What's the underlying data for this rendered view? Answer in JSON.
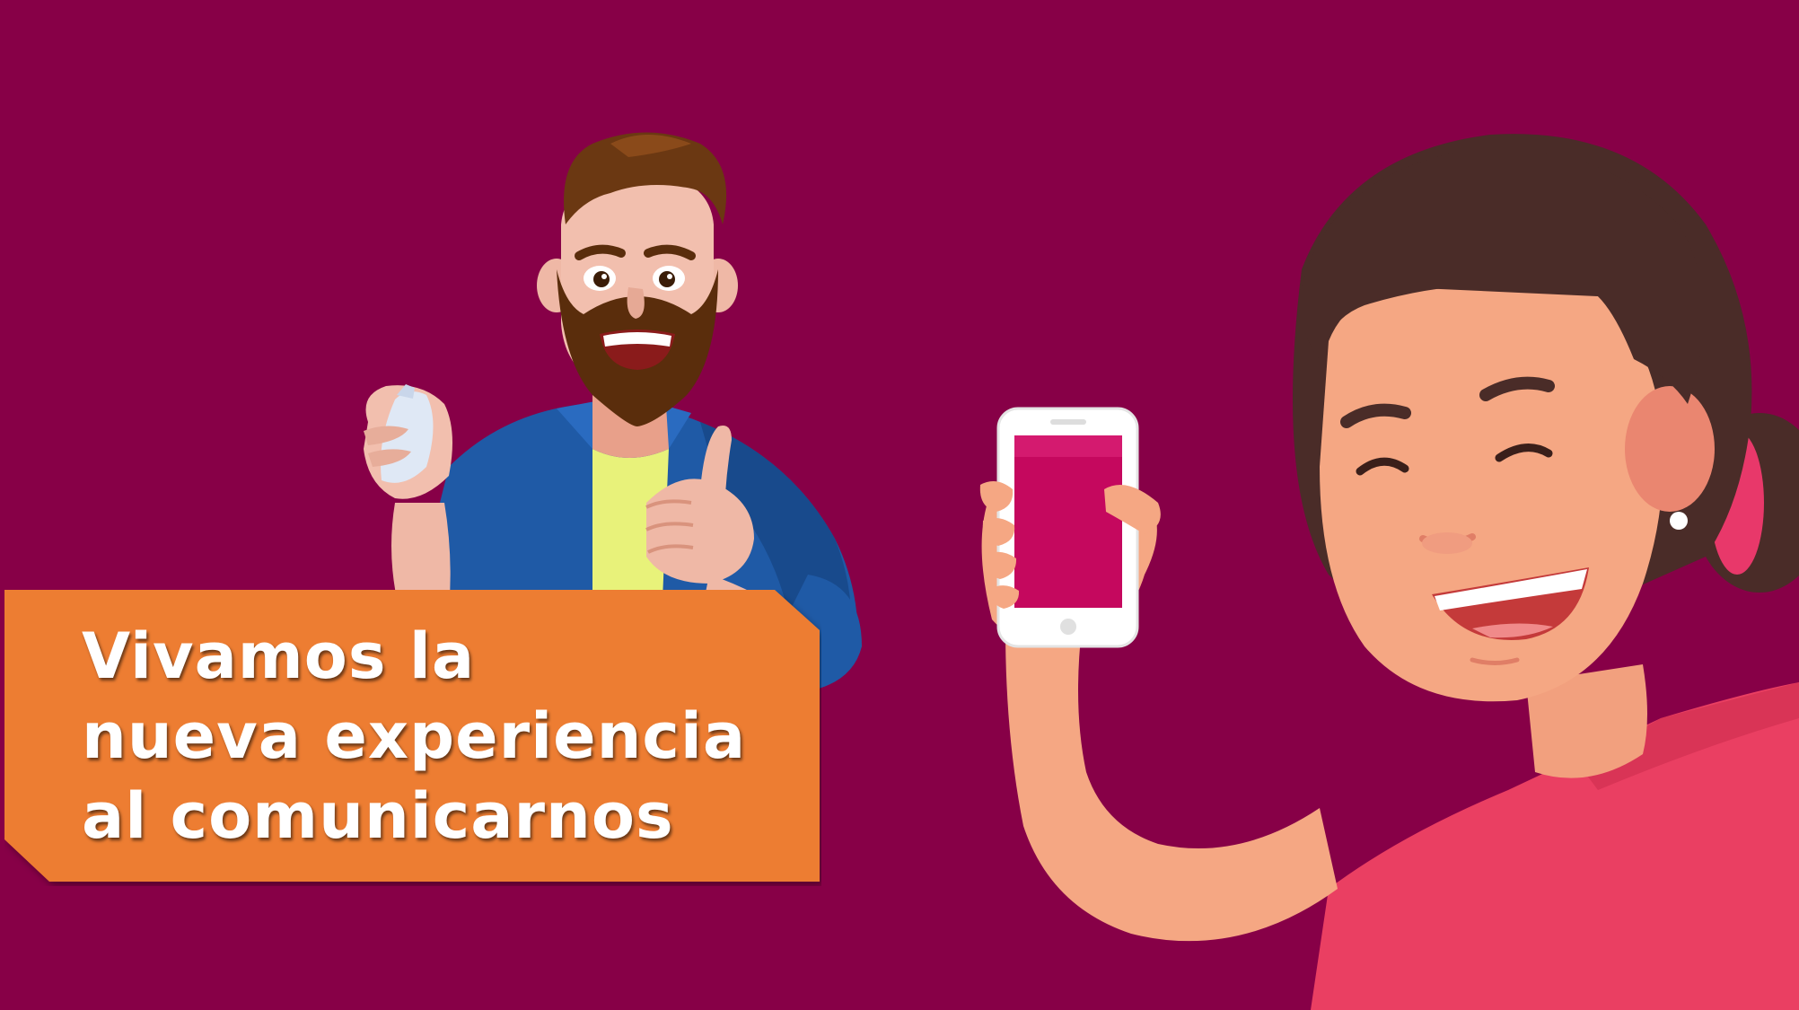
{
  "banner": {
    "lines": [
      "Vivamos la",
      "nueva experiencia",
      "al comunicarnos"
    ]
  },
  "colors": {
    "background": "#870047",
    "banner": "#ED7D31",
    "text": "#FFFFFF"
  },
  "illustration": {
    "left_figure": "man-giving-thumbs-up",
    "right_figure": "woman-holding-phone"
  }
}
